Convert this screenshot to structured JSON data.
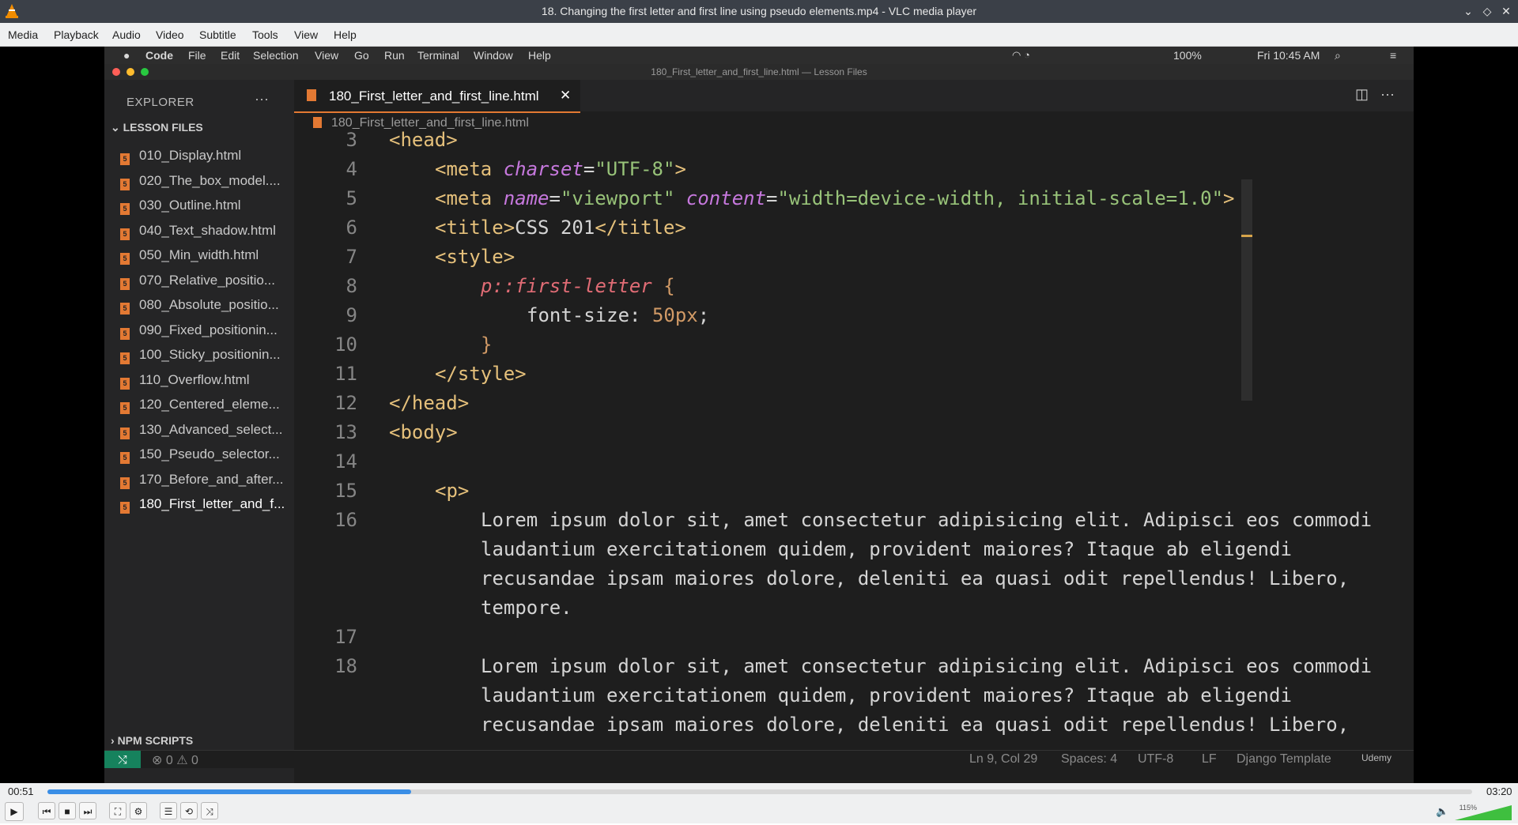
{
  "window": {
    "title": "18. Changing the first letter and first line using pseudo elements.mp4 - VLC media player",
    "icon": "vlc-cone-icon"
  },
  "menubar": [
    "Media",
    "Playback",
    "Audio",
    "Video",
    "Subtitle",
    "Tools",
    "View",
    "Help"
  ],
  "video": {
    "mac_menu": [
      "Code",
      "File",
      "Edit",
      "Selection",
      "View",
      "Go",
      "Run",
      "Terminal",
      "Window",
      "Help"
    ],
    "mac_status": {
      "battery": "100%",
      "clock": "Fri 10:45 AM"
    },
    "window_title": "180_First_letter_and_first_line.html — Lesson Files",
    "explorer": {
      "header": "EXPLORER",
      "section": "LESSON FILES",
      "files": [
        "010_Display.html",
        "020_The_box_model....",
        "030_Outline.html",
        "040_Text_shadow.html",
        "050_Min_width.html",
        "070_Relative_positio...",
        "080_Absolute_positio...",
        "090_Fixed_positionin...",
        "100_Sticky_positionin...",
        "110_Overflow.html",
        "120_Centered_eleme...",
        "130_Advanced_select...",
        "150_Pseudo_selector...",
        "170_Before_and_after...",
        "180_First_letter_and_f..."
      ],
      "npm": "NPM SCRIPTS"
    },
    "tab_label": "180_First_letter_and_first_line.html",
    "breadcrumb": "180_First_letter_and_first_line.html",
    "code": {
      "line_numbers": [
        "3",
        "4",
        "5",
        "6",
        "7",
        "8",
        "9",
        "10",
        "11",
        "12",
        "13",
        "14",
        "15",
        "16",
        "",
        "",
        "",
        "17",
        "18",
        "",
        ""
      ],
      "l3": "<head>",
      "l4a": "<meta ",
      "l4b": "charset",
      "l4c": "=",
      "l4d": "\"UTF-8\"",
      "l4e": ">",
      "l5a": "<meta ",
      "l5b": "name",
      "l5c": "=",
      "l5d": "\"viewport\"",
      "l5e": " content",
      "l5f": "=",
      "l5g": "\"width=device-width, initial-scale=1.0\"",
      "l5h": ">",
      "l6a": "<title>",
      "l6b": "CSS 201",
      "l6c": "</title>",
      "l7": "<style>",
      "l8a": "p::first-letter",
      "l8b": " {",
      "l9a": "font-size: ",
      "l9b": "50px",
      "l9c": ";",
      "l10": "}",
      "l11": "</style>",
      "l12": "</head>",
      "l13": "<body>",
      "l15": "<p>",
      "p1": [
        "Lorem ipsum dolor sit, amet consectetur adipisicing elit. Adipisci eos commodi",
        "laudantium exercitationem quidem, provident maiores? Itaque ab eligendi",
        "recusandae ipsam maiores dolore, deleniti ea quasi odit repellendus! Libero,",
        "tempore."
      ],
      "p2": [
        "Lorem ipsum dolor sit, amet consectetur adipisicing elit. Adipisci eos commodi",
        "laudantium exercitationem quidem, provident maiores? Itaque ab eligendi",
        "recusandae ipsam maiores dolore, deleniti ea quasi odit repellendus! Libero,"
      ]
    },
    "status": {
      "problems": "⊗ 0 ⚠ 0",
      "position": "Ln 9, Col 29",
      "spaces": "Spaces: 4",
      "encoding": "UTF-8",
      "eol": "LF",
      "language": "Django Template",
      "brand": "Udemy"
    }
  },
  "player": {
    "elapsed": "00:51",
    "total": "03:20",
    "progress_fraction": 0.255,
    "volume_label": "115%",
    "volume_fraction": 1.0
  }
}
